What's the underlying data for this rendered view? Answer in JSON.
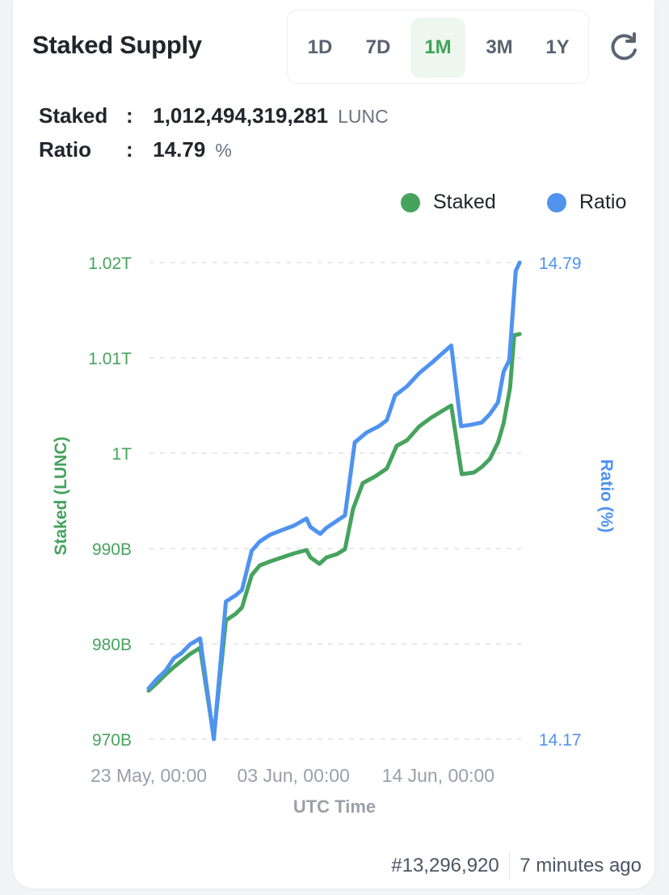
{
  "header": {
    "title": "Staked Supply",
    "ranges": [
      "1D",
      "7D",
      "1M",
      "3M",
      "1Y"
    ],
    "active_range": "1M",
    "refresh_icon": "refresh-icon"
  },
  "summary": {
    "staked_label": "Staked",
    "staked_value": "1,012,494,319,281",
    "staked_unit": "LUNC",
    "ratio_label": "Ratio",
    "ratio_value": "14.79",
    "ratio_unit": "%",
    "separator": ":"
  },
  "colors": {
    "staked": "#46a35e",
    "ratio": "#4f93ef",
    "active_range_bg": "#edf7ee",
    "active_range_text": "#3fa45a"
  },
  "footer": {
    "block": "#13,296,920",
    "updated": "7 minutes ago"
  },
  "chart_data": {
    "type": "line",
    "title": "",
    "xlabel": "UTC Time",
    "ylabel": "Staked (LUNC)",
    "y2label": "Ratio (%)",
    "legend": [
      "Staked",
      "Ratio"
    ],
    "legend_position": "top-right",
    "grid": true,
    "x_unit": "days since 23 May, 00:00",
    "x_range": [
      0,
      28.3
    ],
    "x_ticks": [
      {
        "x": 0,
        "label": "23 May, 00:00"
      },
      {
        "x": 11,
        "label": "03 Jun, 00:00"
      },
      {
        "x": 22,
        "label": "14 Jun, 00:00"
      }
    ],
    "y_range": [
      970,
      1020
    ],
    "y_unit": "billion LUNC",
    "y_ticks": [
      {
        "v": 970,
        "label": "970B"
      },
      {
        "v": 980,
        "label": "980B"
      },
      {
        "v": 990,
        "label": "990B"
      },
      {
        "v": 1000,
        "label": "1T"
      },
      {
        "v": 1010,
        "label": "1.01T"
      },
      {
        "v": 1020,
        "label": "1.02T"
      }
    ],
    "y2_range": [
      14.17,
      14.79
    ],
    "y2_ticks": [
      {
        "v": 14.17,
        "label": "14.17"
      },
      {
        "v": 14.79,
        "label": "14.79"
      }
    ],
    "series": [
      {
        "name": "Staked",
        "axis": "left",
        "x": [
          0,
          0.67,
          1.29,
          1.9,
          2.51,
          3.12,
          3.91,
          4.95,
          5.87,
          6.61,
          7.09,
          7.83,
          8.44,
          9.24,
          10.15,
          11.07,
          11.99,
          12.29,
          12.97,
          13.52,
          14.31,
          14.92,
          15.53,
          16.27,
          17.19,
          18.1,
          18.84,
          19.63,
          20.55,
          21.47,
          22.38,
          22.99,
          23.79,
          24.71,
          25.32,
          25.93,
          26.54,
          26.97,
          27.46,
          27.77,
          28.19
        ],
        "values": [
          975.08,
          975.93,
          976.78,
          977.54,
          978.22,
          978.9,
          979.58,
          970.2,
          982.46,
          983.14,
          983.81,
          987.2,
          988.22,
          988.64,
          989.07,
          989.49,
          989.83,
          989.07,
          988.39,
          989.07,
          989.41,
          989.92,
          994.15,
          996.86,
          997.54,
          998.39,
          1000.76,
          1001.36,
          1002.8,
          1003.73,
          1004.49,
          1005.0,
          997.8,
          997.97,
          998.56,
          999.41,
          1001.1,
          1003.14,
          1006.86,
          1012.37,
          1012.49
        ]
      },
      {
        "name": "Ratio",
        "axis": "right",
        "x": [
          0,
          0.67,
          1.29,
          1.9,
          2.51,
          3.12,
          3.91,
          4.95,
          5.87,
          6.61,
          7.09,
          7.83,
          8.44,
          9.24,
          10.15,
          11.07,
          11.99,
          12.29,
          13.03,
          13.52,
          14.31,
          14.92,
          15.66,
          16.57,
          17.49,
          18.1,
          18.72,
          19.63,
          20.55,
          21.47,
          22.26,
          22.99,
          23.73,
          24.52,
          25.32,
          25.93,
          26.54,
          26.97,
          27.4,
          27.89,
          28.19
        ],
        "values": [
          14.236,
          14.249,
          14.259,
          14.275,
          14.282,
          14.293,
          14.301,
          14.17,
          14.349,
          14.357,
          14.364,
          14.415,
          14.427,
          14.436,
          14.442,
          14.448,
          14.457,
          14.446,
          14.437,
          14.445,
          14.454,
          14.461,
          14.556,
          14.569,
          14.577,
          14.585,
          14.617,
          14.629,
          14.646,
          14.659,
          14.671,
          14.682,
          14.577,
          14.579,
          14.582,
          14.593,
          14.608,
          14.648,
          14.663,
          14.779,
          14.79
        ]
      }
    ]
  }
}
